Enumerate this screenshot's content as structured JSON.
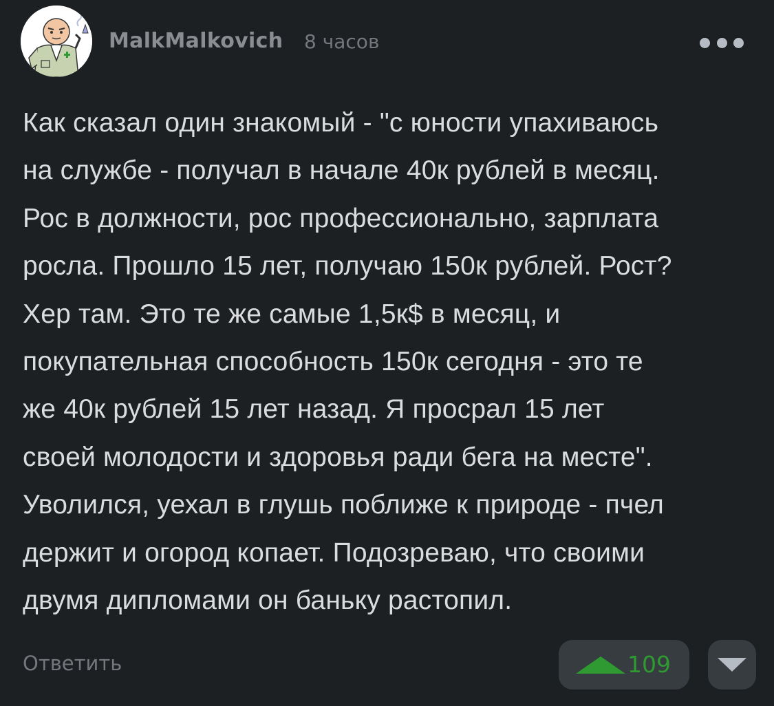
{
  "comment": {
    "author": "MalkMalkovich",
    "time": "8 часов",
    "text": "Как сказал один знакомый - \"с юности упахиваюсь\nна службе - получал в начале 40к рублей в месяц.\nРос в должности, рос профессионально, зарплата\nросла. Прошло 15 лет, получаю 150к рублей. Рост?\nХер там. Это те же самые 1,5к$ в месяц, и\nпокупательная способность 150к сегодня - это те\nже 40к рублей 15 лет назад. Я просрал 15 лет\nсвоей молодости и здоровья ради бега на месте\".\nУволился, уехал в глушь поближе к природе - пчел\nдержит и огород копает. Подозреваю, что своими\nдвумя дипломами он баньку растопил.",
    "reply_label": "Ответить",
    "rating": "109"
  },
  "icons": {
    "avatar": "avatar-illustration",
    "more": "more-dots-icon",
    "upvote": "upvote-arrow-icon",
    "downvote": "downvote-arrow-icon"
  },
  "colors": {
    "background": "#1d2023",
    "text": "#dadcdf",
    "muted": "#74777b",
    "upvote_green": "#2f9a31",
    "button_bg": "#373c40"
  }
}
